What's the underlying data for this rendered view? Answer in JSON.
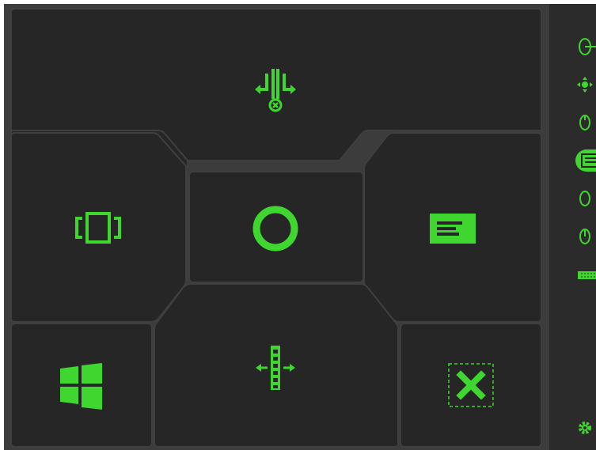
{
  "accent_color": "#3fd62f",
  "tile_color": "#262626",
  "background_color": "#3c3c3c",
  "tiles": [
    {
      "id": "top",
      "icon": "split-arrows-icon"
    },
    {
      "id": "left",
      "icon": "window-switch-icon"
    },
    {
      "id": "center",
      "icon": "ring-icon"
    },
    {
      "id": "right",
      "icon": "text-block-icon"
    },
    {
      "id": "bottom-left",
      "icon": "windows-logo-icon"
    },
    {
      "id": "bottom-center",
      "icon": "horizontal-scroll-icon"
    },
    {
      "id": "bottom-right",
      "icon": "close-dashed-icon"
    }
  ],
  "rail_items": [
    {
      "icon": "mouse-arrow-icon",
      "active": false
    },
    {
      "icon": "move-dpad-icon",
      "active": false
    },
    {
      "icon": "mouse-icon",
      "active": false
    },
    {
      "icon": "touchpad-icon",
      "active": true
    },
    {
      "icon": "mouse-left-icon",
      "active": false
    },
    {
      "icon": "mouse-scroll-icon",
      "active": false
    },
    {
      "icon": "keyboard-icon",
      "active": false
    },
    {
      "icon": "gear-icon",
      "active": false
    }
  ]
}
